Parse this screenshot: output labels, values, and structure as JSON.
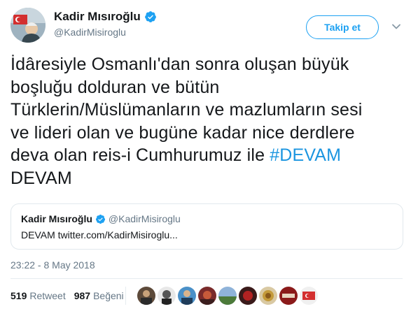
{
  "author": {
    "display_name": "Kadir Mısıroğlu",
    "handle": "@KadirMisiroglu",
    "verified": true
  },
  "follow_button": {
    "label": "Takip et"
  },
  "tweet": {
    "text_lines": [
      "İdâresiyle Osmanlı'dan sonra oluşan büyük",
      "boşluğu dolduran ve bütün",
      "Türklerin/Müslümanların ve mazlumların sesi",
      "ve lideri olan ve bugüne kadar nice derdlere",
      "deva olan reis-i Cumhurumuz ile "
    ],
    "hashtag": "#DEVAM",
    "last_line": "DEVAM"
  },
  "quote": {
    "display_name": "Kadir Mısıroğlu",
    "handle": "@KadirMisiroglu",
    "text": "DEVAM twitter.com/KadirMisiroglu..."
  },
  "timestamp": "23:22 - 8 May 2018",
  "stats": {
    "retweets_count": "519",
    "retweets_label": "Retweet",
    "likes_count": "987",
    "likes_label": "Beğeni"
  },
  "colors": {
    "accent": "#1da1f2",
    "hashtag": "#1b95e0",
    "muted": "#657786",
    "border": "#e1e8ed"
  },
  "icons": {
    "verified": "verified-badge-icon",
    "caret": "chevron-down-icon"
  }
}
